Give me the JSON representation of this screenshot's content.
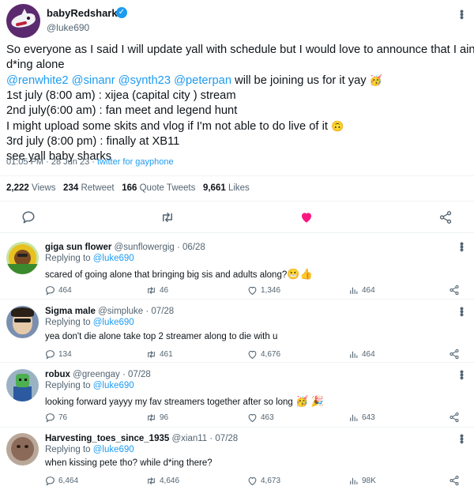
{
  "tweet": {
    "display_name": "babyRedshark",
    "handle": "@luke690",
    "verified": true,
    "lines": [
      {
        "text": "So everyone as I said I will update yall with schedule but I would love to announce that I ain't"
      },
      {
        "text": "d*ing alone"
      },
      {
        "mentions": "@renwhite2 @sinanr @synth23 @peterpan",
        "text": " will be joining us for it yay"
      },
      {
        "text": "1st july (8:00 am) : xijea (capital city ) stream"
      },
      {
        "text": "2nd july(6:00 am) : fan meet and legend hunt"
      },
      {
        "text": "I might upload some skits and vlog if I'm not able to do live of it"
      },
      {
        "text": "3rd july (8:00 pm) : finally at XB11"
      },
      {
        "text": "see yall baby sharks"
      }
    ],
    "time": "01:05 PM",
    "date": "28 Jun 23",
    "sep": "·",
    "app": "twitter for gayphone",
    "stats": {
      "views_value": "2,222",
      "views_label": "Views",
      "retweets_value": "234",
      "retweets_label": "Retweet",
      "quotes_value": "166",
      "quotes_label": "Quote Tweets",
      "likes_value": "9,661",
      "likes_label": "Likes"
    },
    "liked": true
  },
  "colors": {
    "accent": "#1d9bf0",
    "like": "#f91880",
    "muted": "#536471"
  },
  "replies": [
    {
      "name": "giga sun flower",
      "handle": "@sunflowergig",
      "date": "· 06/28",
      "replying_label": "Replying to",
      "replying_to": "@luke690",
      "text": "scared of going alone that bringing big sis and adults along?",
      "replies": "464",
      "retweets": "46",
      "likes": "1,346",
      "views": "464"
    },
    {
      "name": "Sigma male",
      "handle": "@simpluke",
      "date": "· 07/28",
      "replying_label": "Replying to",
      "replying_to": "@luke690",
      "text": "yea don't die alone take top 2 streamer along to die with u",
      "replies": "134",
      "retweets": "461",
      "likes": "4,676",
      "views": "464"
    },
    {
      "name": "robux",
      "handle": "@greengay",
      "date": "· 07/28",
      "replying_label": "Replying to",
      "replying_to": "@luke690",
      "text": "looking forward yayyy my fav streamers together after so long",
      "replies": "76",
      "retweets": "96",
      "likes": "463",
      "views": "643"
    },
    {
      "name": "Harvesting_toes_since_1935",
      "handle": "@xian11",
      "date": "· 07/28",
      "replying_label": "Replying to",
      "replying_to": "@luke690",
      "text": "when kissing pete tho? while d*ing there?",
      "replies": "6,464",
      "retweets": "4,646",
      "likes": "4,673",
      "views": "98K"
    }
  ]
}
